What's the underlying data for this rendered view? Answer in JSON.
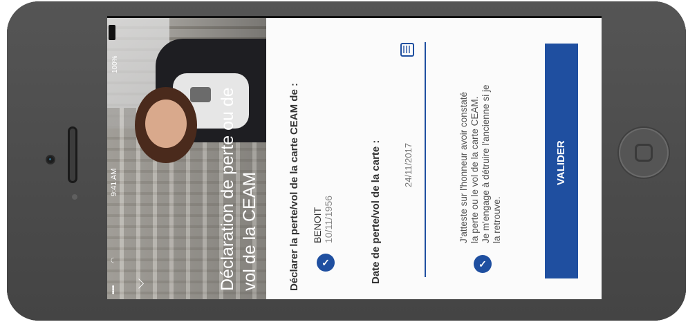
{
  "status_bar": {
    "signal": "•••••",
    "time": "9:41 AM",
    "battery": "100%"
  },
  "header": {
    "title_line1": "Déclaration de perte ou de",
    "title_line2": "vol de la CEAM"
  },
  "form": {
    "declare_label": "Déclarer la perte/vol de la carte CEAM de :",
    "person_name": "BENOIT",
    "person_birthdate": "10/11/1956",
    "date_label": "Date de perte/vol de la carte :",
    "date_value": "24/11/2017",
    "attest_lines": [
      "J'atteste sur l'honneur avoir constaté",
      "la perte ou le vol de la carte CEAM.",
      "Je m'engage à détruire l'ancienne si je",
      "la retrouve."
    ],
    "submit_label": "VALIDER"
  },
  "colors": {
    "accent": "#1f4fa0",
    "phone_body": "#4a4a4a"
  }
}
